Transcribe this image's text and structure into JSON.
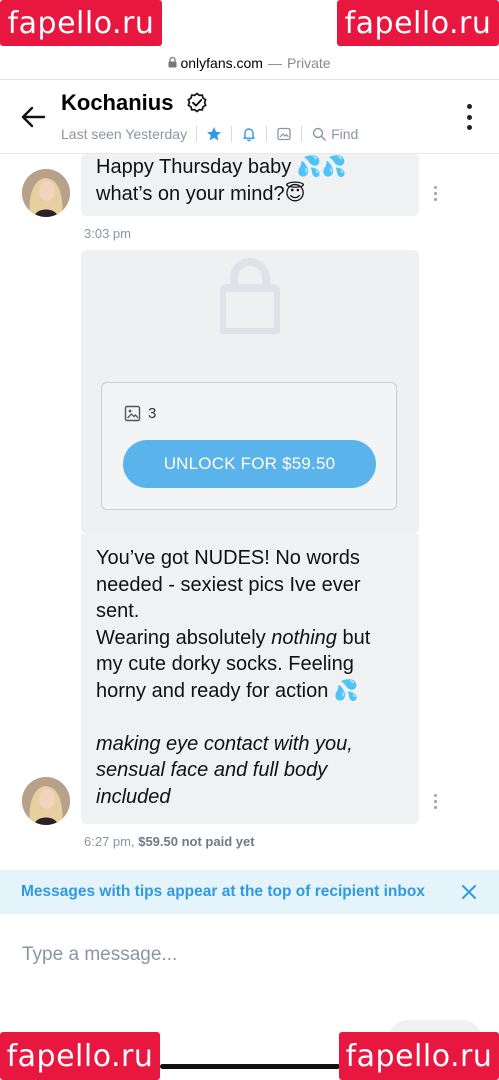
{
  "watermark": {
    "text": "fapello.ru",
    "color": "#e8173f"
  },
  "browser": {
    "domain": "onlyfans.com",
    "separator": "—",
    "mode": "Private"
  },
  "header": {
    "name": "Kochanius",
    "last_seen": "Last seen Yesterday",
    "find_label": "Find"
  },
  "messages": [
    {
      "lines": [
        "Happy Thursday baby 💦💦",
        "what’s on your mind?😇"
      ],
      "time": "3:03 pm"
    },
    {
      "media_count": "3",
      "unlock_label": "UNLOCK FOR $59.50",
      "text_plain_1": "You’ve got NUDES! No words needed - sexiest pics Ive ever sent.",
      "text_plain_2a": "Wearing absolutely ",
      "text_em": "nothing",
      "text_plain_2b": " but my cute dorky socks. Feeling horny and ready for action 💦",
      "text_italic": "making eye contact with you, sensual face and full body included",
      "time": "6:27 pm,",
      "price_status": "$59.50 not paid yet"
    }
  ],
  "tips_banner": {
    "text": "Messages with tips appear at the top of recipient inbox"
  },
  "composer": {
    "placeholder": "Type a message..."
  },
  "colors": {
    "accent": "#00aff0",
    "button": "#5bb3ec",
    "tips_text": "#2e9ae3",
    "tips_bg": "#e5f3fb"
  },
  "icons": [
    "lock-icon",
    "back-arrow-icon",
    "verified-icon",
    "star-icon",
    "bell-icon",
    "image-icon",
    "search-icon",
    "more-icon",
    "close-icon"
  ]
}
